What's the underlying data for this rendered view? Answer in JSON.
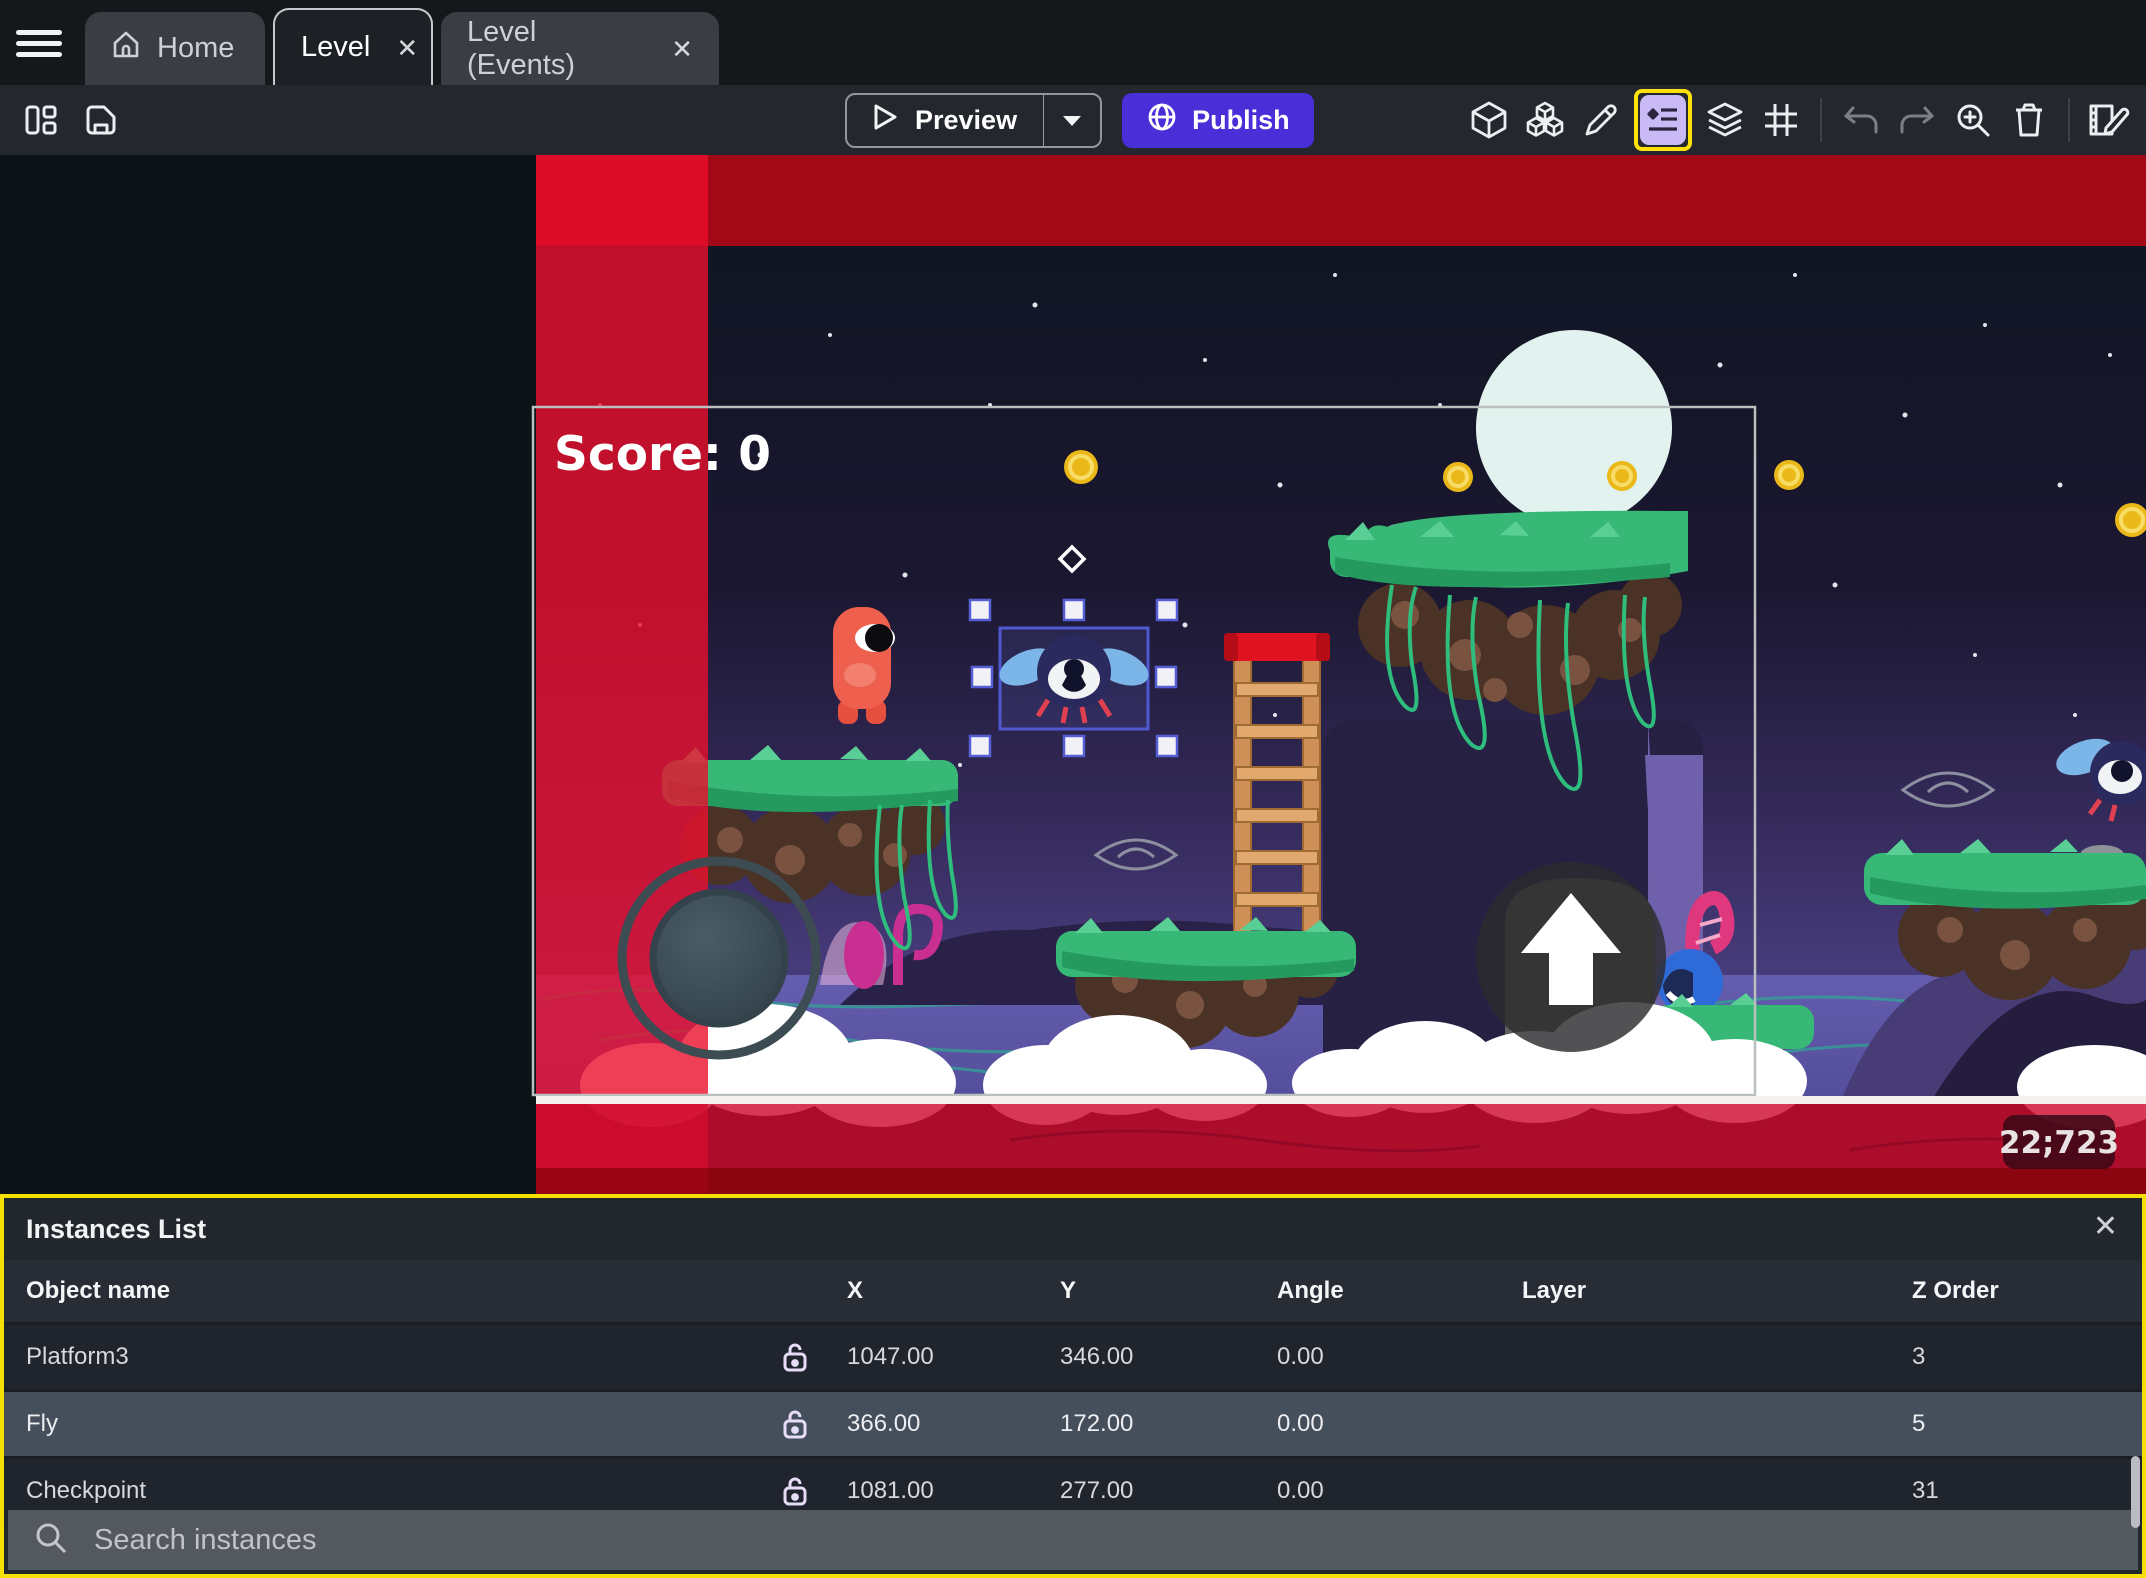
{
  "tabs": {
    "home": "Home",
    "level": "Level",
    "level_events": "Level (Events)",
    "close_glyph": "✕"
  },
  "toolbar": {
    "preview_label": "Preview",
    "publish_label": "Publish",
    "icons": [
      "layout-icon",
      "save-icon",
      "cube-icon",
      "cubes-icon",
      "pencil-icon",
      "instances-list-icon",
      "layers-icon",
      "grid-icon",
      "undo-icon",
      "redo-icon",
      "zoom-in-icon",
      "trash-icon",
      "edit-events-icon"
    ]
  },
  "scene": {
    "score_text": "Score: 0",
    "coords_badge": "22;723",
    "selected_instance": "Fly",
    "hud_icons": [
      "joystick-control",
      "jump-button"
    ]
  },
  "instances_panel": {
    "title": "Instances List",
    "close_glyph": "✕",
    "columns": {
      "name": "Object name",
      "x": "X",
      "y": "Y",
      "angle": "Angle",
      "layer": "Layer",
      "z_order": "Z Order"
    },
    "rows": [
      {
        "name": "Platform3",
        "x": "1047.00",
        "y": "346.00",
        "angle": "0.00",
        "layer": "",
        "z_order": "3"
      },
      {
        "name": "Fly",
        "x": "366.00",
        "y": "172.00",
        "angle": "0.00",
        "layer": "",
        "z_order": "5"
      },
      {
        "name": "Checkpoint",
        "x": "1081.00",
        "y": "277.00",
        "angle": "0.00",
        "layer": "",
        "z_order": "31"
      }
    ],
    "search_placeholder": "Search instances"
  },
  "colors": {
    "accent_purple": "#4a2ed8",
    "highlight_yellow": "#ffe10a",
    "selection_blue": "#4f58cf",
    "red_overlay": "#c81030",
    "panel_bg": "#22262d",
    "grass_green": "#37b877",
    "coin_gold": "#f5c center518"
  }
}
